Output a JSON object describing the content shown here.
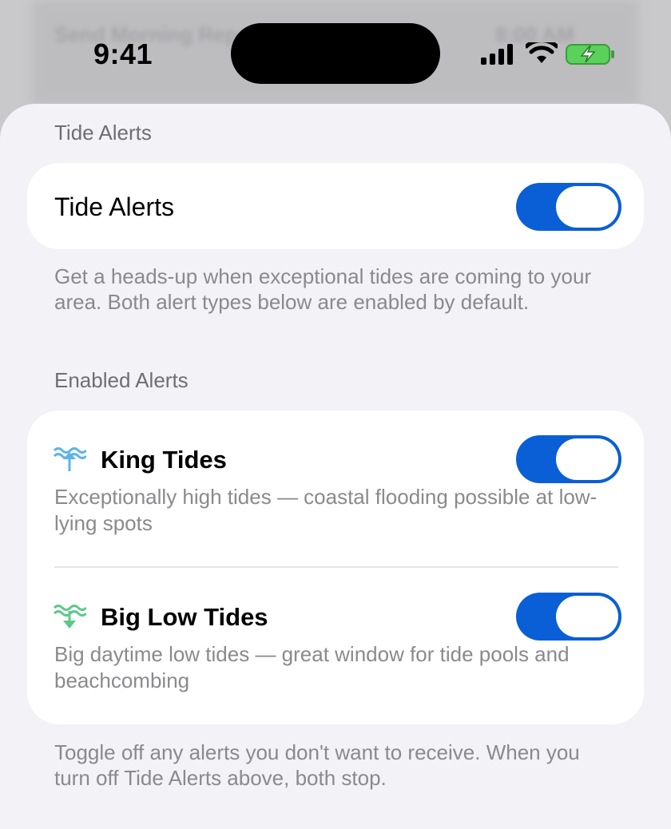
{
  "status_bar": {
    "time": "9:41"
  },
  "background": {
    "ghost_left": "Send Morning Report",
    "ghost_right": "8:00 AM"
  },
  "sheet": {
    "header_main": "Tide Alerts",
    "main_toggle": {
      "label": "Tide Alerts",
      "on": true
    },
    "main_footer": "Get a heads-up when exceptional tides are coming to your area. Both alert types below are enabled by default.",
    "header_enabled": "Enabled Alerts",
    "alerts": [
      {
        "title": "King Tides",
        "description": "Exceptionally high tides — coastal flooding possible at low-lying spots",
        "icon": "king-tide-icon",
        "icon_color": "#5ab4ea",
        "on": true
      },
      {
        "title": "Big Low Tides",
        "description": "Big daytime low tides — great window for tide pools and beachcombing",
        "icon": "low-tide-icon",
        "icon_color": "#5cc98a",
        "on": true
      }
    ],
    "bottom_footer": "Toggle off any alerts you don't want to receive. When you turn off Tide Alerts above, both stop."
  },
  "colors": {
    "toggle_on": "#0a5fd6",
    "sheet_bg": "#f2f2f7",
    "card_bg": "#ffffff",
    "secondary_text": "#8a8a8e"
  }
}
